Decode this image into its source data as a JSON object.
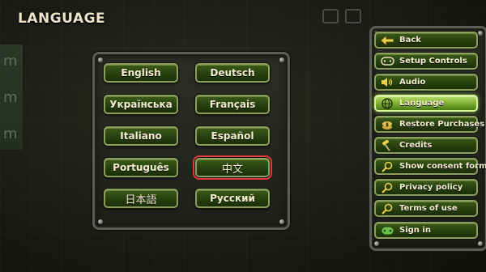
{
  "header": {
    "title": "LANGUAGE"
  },
  "languages": [
    {
      "label": "English"
    },
    {
      "label": "Deutsch"
    },
    {
      "label": "Українська"
    },
    {
      "label": "Français"
    },
    {
      "label": "Italiano"
    },
    {
      "label": "Español"
    },
    {
      "label": "Português"
    },
    {
      "label": "中文",
      "highlighted": true
    },
    {
      "label": "日本語"
    },
    {
      "label": "Русский"
    }
  ],
  "menu": {
    "items": [
      {
        "label": "Back",
        "icon": "arrow-left-icon"
      },
      {
        "label": "Setup Controls",
        "icon": "gamepad-icon"
      },
      {
        "label": "Audio",
        "icon": "speaker-icon"
      },
      {
        "label": "Language",
        "icon": "globe-icon",
        "active": true
      },
      {
        "label": "Restore Purchases",
        "icon": "money-icon"
      },
      {
        "label": "Credits",
        "icon": "hammer-icon"
      },
      {
        "label": "Show consent form",
        "icon": "magnifier-icon"
      },
      {
        "label": "Privacy policy",
        "icon": "magnifier-icon"
      },
      {
        "label": "Terms of use",
        "icon": "magnifier-icon"
      },
      {
        "label": "Sign in",
        "icon": "gamepad-green-icon"
      }
    ]
  },
  "colors": {
    "button_green": "#2a4510",
    "button_border": "#8d9d60",
    "active_green": "#7fb033",
    "highlight_red": "#e23a35",
    "text": "#f3ecd0"
  }
}
